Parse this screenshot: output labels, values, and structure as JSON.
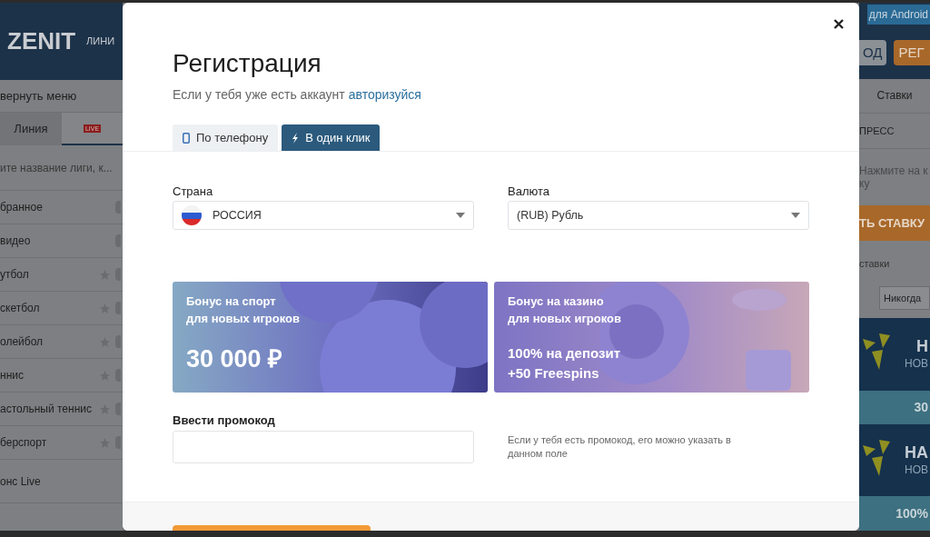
{
  "background_page": {
    "logo": "ZENIT",
    "nav_item": "ЛИНИ",
    "sidebar": {
      "collapse": "вернуть меню",
      "tabs": [
        {
          "label": "Линия",
          "selected": false
        },
        {
          "label": "LIVE",
          "selected": true
        }
      ],
      "search": {
        "placeholder": "ите название лиги, к..."
      },
      "items": [
        {
          "label": "бранное",
          "star": false
        },
        {
          "label": "видео",
          "star": false
        },
        {
          "label": "утбол",
          "star": true
        },
        {
          "label": "скетбол",
          "star": true
        },
        {
          "label": "олейбол",
          "star": true
        },
        {
          "label": "ннис",
          "star": true
        },
        {
          "label": "астольный теннис",
          "star": true
        },
        {
          "label": "берспорт",
          "star": true
        }
      ],
      "footer_item": "онс Live"
    },
    "right_panel": {
      "app_link": "для Android",
      "login_button": "ОД",
      "register_button": "РЕГ",
      "tab": "Ставки",
      "express": "ПРЕСС",
      "hint_lines": [
        "Нажмите на к",
        "ку"
      ],
      "place_bet_button": "ТЬ СТАВКУ",
      "setting_label": "ставки",
      "setting_value": "Никогда",
      "banners": [
        {
          "kind": "promo",
          "title": "Н",
          "subtitle": "НОВ"
        },
        {
          "kind": "strip",
          "title": "30"
        },
        {
          "kind": "promo",
          "title": "НА",
          "subtitle": "НОВ"
        },
        {
          "kind": "strip",
          "title": "100%"
        }
      ]
    }
  },
  "modal": {
    "title": "Регистрация",
    "subtitle": "Если у тебя уже есть аккаунт",
    "login_link": "авторизуйся",
    "tabs": [
      {
        "label": "По телефону",
        "kind": "phone",
        "selected": false
      },
      {
        "label": "В один клик",
        "kind": "bolt",
        "selected": true
      }
    ],
    "country": {
      "label": "Страна",
      "value": "РОССИЯ"
    },
    "currency": {
      "label": "Валюта",
      "value": "(RUB) Рубль"
    },
    "bonuses": [
      {
        "kind": "sport",
        "lines": [
          "Бонус на спорт",
          "для новых игроков"
        ],
        "highlight": [
          "30 000 ₽"
        ]
      },
      {
        "kind": "casino",
        "lines": [
          "Бонус на казино",
          "для новых игроков"
        ],
        "highlight": [
          "100% на депозит",
          "+50 Freespins"
        ]
      }
    ],
    "promo": {
      "label": "Ввести промокод",
      "hint": "Если у тебя есть промокод, его можно указать в данном поле"
    }
  }
}
